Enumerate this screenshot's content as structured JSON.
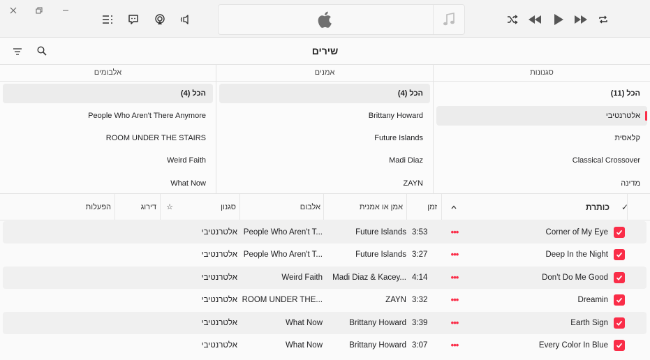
{
  "window": {
    "page_title": "שירים"
  },
  "browser": {
    "genres": {
      "header": "סגנונות",
      "items": [
        "הכל (11)",
        "אלטרנטיבי",
        "קלאסית",
        "Classical Crossover",
        "מדינה"
      ]
    },
    "artists": {
      "header": "אמנים",
      "items": [
        "הכל (4)",
        "Brittany Howard",
        "Future Islands",
        "Madi Diaz",
        "ZAYN"
      ]
    },
    "albums": {
      "header": "אלבומים",
      "items": [
        "הכל (4)",
        "People Who Aren't There Anymore",
        "ROOM UNDER THE STAIRS",
        "Weird Faith",
        "What Now"
      ]
    }
  },
  "table": {
    "headers": {
      "check": "✓",
      "title": "כותרת",
      "sort_icon": "chevron-up-icon",
      "time": "זמן",
      "artist": "אמן או אמנית",
      "album": "אלבום",
      "genre": "סגנון",
      "favorite": "☆",
      "rating": "דירוג",
      "plays": "הפעלות"
    },
    "rows": [
      {
        "title": "Corner of My Eye",
        "time": "3:53",
        "artist": "Future Islands",
        "album": "People Who Aren't T...",
        "genre": "אלטרנטיבי"
      },
      {
        "title": "Deep In the Night",
        "time": "3:27",
        "artist": "Future Islands",
        "album": "People Who Aren't T...",
        "genre": "אלטרנטיבי"
      },
      {
        "title": "Don't Do Me Good",
        "time": "4:14",
        "artist": "Madi Diaz & Kacey...",
        "album": "Weird Faith",
        "genre": "אלטרנטיבי"
      },
      {
        "title": "Dreamin",
        "time": "3:32",
        "artist": "ZAYN",
        "album": "ROOM UNDER THE...",
        "genre": "אלטרנטיבי"
      },
      {
        "title": "Earth Sign",
        "time": "3:39",
        "artist": "Brittany Howard",
        "album": "What Now",
        "genre": "אלטרנטיבי"
      },
      {
        "title": "Every Color In Blue",
        "time": "3:07",
        "artist": "Brittany Howard",
        "album": "What Now",
        "genre": "אלטרנטיבי"
      }
    ],
    "more_glyph": "•••"
  },
  "colors": {
    "accent": "#fa2d48",
    "selection": "#ececec",
    "row_alt": "#f0f0f0"
  }
}
